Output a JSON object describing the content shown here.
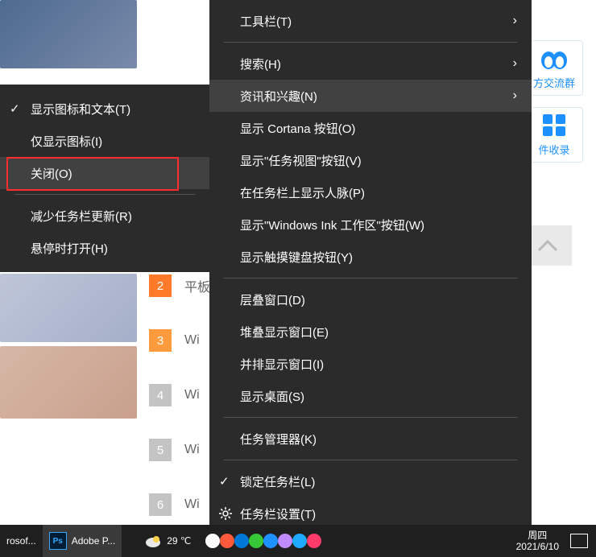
{
  "submenu": {
    "items": [
      {
        "label": "显示图标和文本(T)",
        "checked": true
      },
      {
        "label": "仅显示图标(I)"
      },
      {
        "label": "关闭(O)",
        "hot": true
      },
      {
        "sep": true
      },
      {
        "label": "减少任务栏更新(R)"
      },
      {
        "label": "悬停时打开(H)"
      }
    ]
  },
  "mainmenu": {
    "items": [
      {
        "label": "工具栏(T)",
        "sub": true
      },
      {
        "sep": true
      },
      {
        "label": "搜索(H)",
        "sub": true
      },
      {
        "label": "资讯和兴趣(N)",
        "sub": true,
        "hot": true
      },
      {
        "label": "显示 Cortana 按钮(O)"
      },
      {
        "label": "显示\"任务视图\"按钮(V)"
      },
      {
        "label": "在任务栏上显示人脉(P)"
      },
      {
        "label": "显示\"Windows Ink 工作区\"按钮(W)"
      },
      {
        "label": "显示触摸键盘按钮(Y)"
      },
      {
        "sep": true
      },
      {
        "label": "层叠窗口(D)"
      },
      {
        "label": "堆叠显示窗口(E)"
      },
      {
        "label": "并排显示窗口(I)"
      },
      {
        "label": "显示桌面(S)"
      },
      {
        "sep": true
      },
      {
        "label": "任务管理器(K)"
      },
      {
        "sep": true
      },
      {
        "label": "锁定任务栏(L)",
        "checked": true
      },
      {
        "label": "任务栏设置(T)",
        "icon": "gear"
      }
    ]
  },
  "bglist": [
    {
      "n": "2",
      "c": "#ff7b29",
      "t": "平板"
    },
    {
      "n": "3",
      "c": "#ff9a3d",
      "t": "Wi"
    },
    {
      "n": "4",
      "c": "#c4c4c4",
      "t": "Wi"
    },
    {
      "n": "5",
      "c": "#c4c4c4",
      "t": "Wi"
    },
    {
      "n": "6",
      "c": "#c4c4c4",
      "t": "Wi"
    }
  ],
  "side": {
    "group": "方交流群",
    "collect": "件收录"
  },
  "taskbar": {
    "left": "rosof...",
    "app": "Adobe P...",
    "temp": "29 ℃",
    "day": "周四",
    "date": "2021/6/10"
  }
}
